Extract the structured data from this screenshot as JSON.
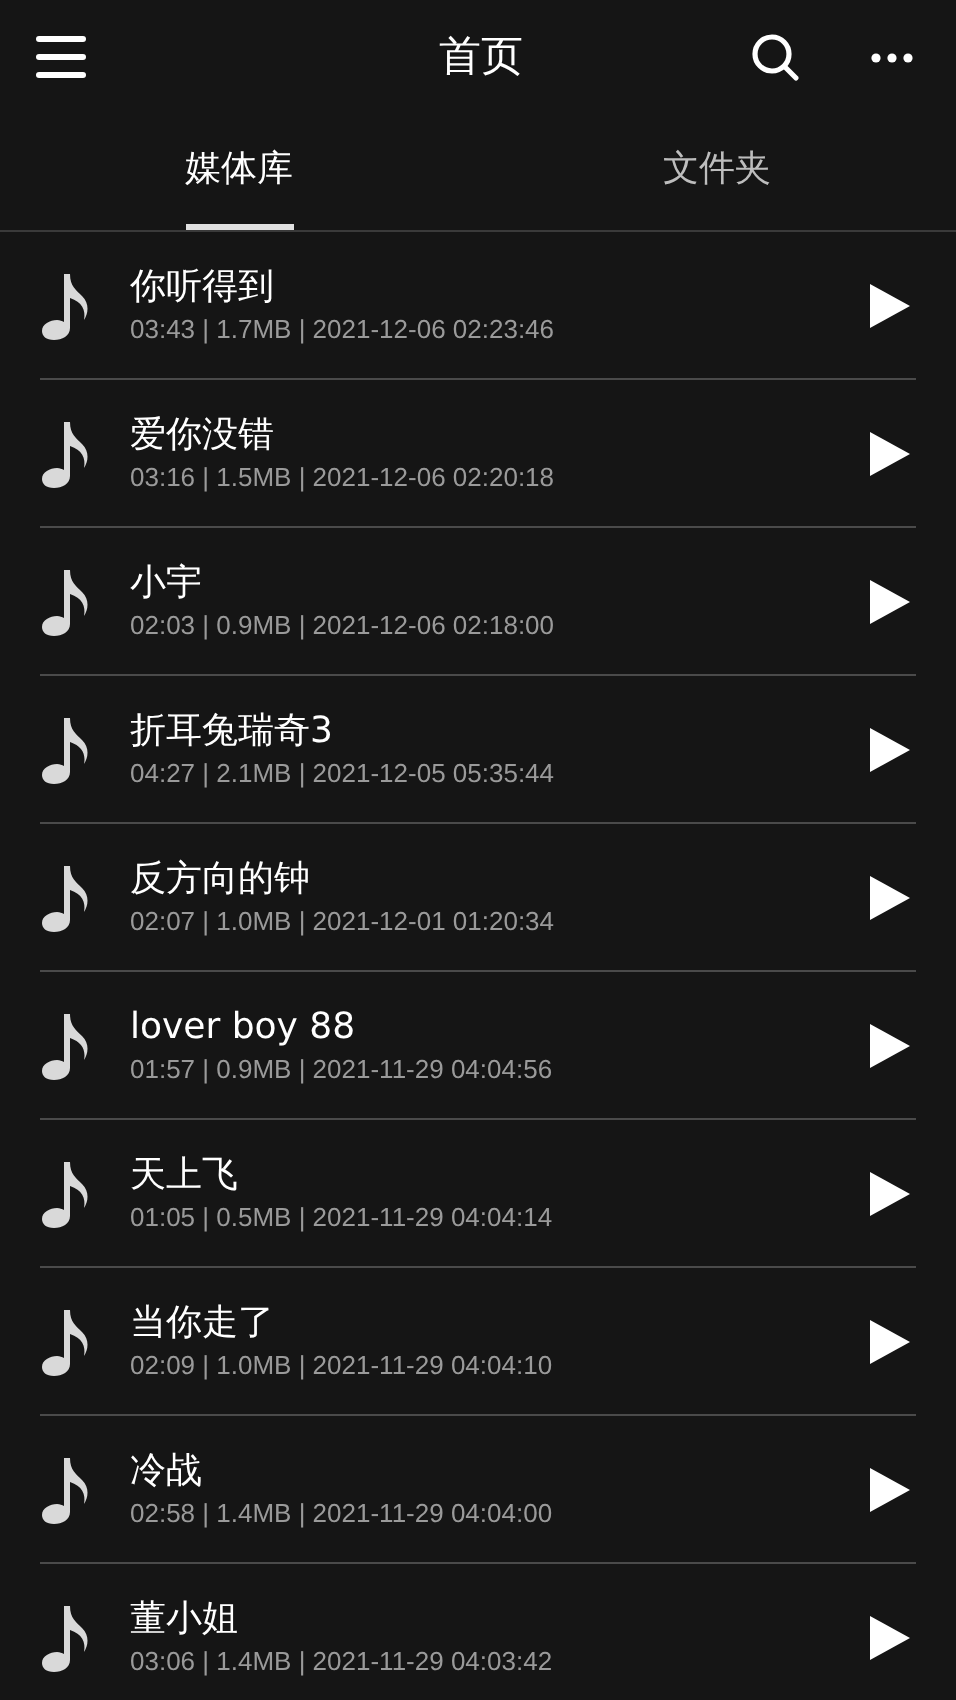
{
  "header": {
    "title": "首页"
  },
  "tabs": [
    {
      "label": "媒体库",
      "selected": true
    },
    {
      "label": "文件夹",
      "selected": false
    }
  ],
  "songs": [
    {
      "title": "你听得到",
      "meta": "03:43 | 1.7MB | 2021-12-06 02:23:46"
    },
    {
      "title": "爱你没错",
      "meta": "03:16 | 1.5MB | 2021-12-06 02:20:18"
    },
    {
      "title": "小宇",
      "meta": "02:03 | 0.9MB | 2021-12-06 02:18:00"
    },
    {
      "title": "折耳兔瑞奇3",
      "meta": "04:27 | 2.1MB | 2021-12-05 05:35:44"
    },
    {
      "title": "反方向的钟",
      "meta": "02:07 | 1.0MB | 2021-12-01 01:20:34"
    },
    {
      "title": "lover boy 88",
      "meta": "01:57 | 0.9MB | 2021-11-29 04:04:56"
    },
    {
      "title": "天上飞",
      "meta": "01:05 | 0.5MB | 2021-11-29 04:04:14"
    },
    {
      "title": "当你走了",
      "meta": "02:09 | 1.0MB | 2021-11-29 04:04:10"
    },
    {
      "title": "冷战",
      "meta": "02:58 | 1.4MB | 2021-11-29 04:04:00"
    },
    {
      "title": "董小姐",
      "meta": "03:06 | 1.4MB | 2021-11-29 04:03:42"
    }
  ]
}
